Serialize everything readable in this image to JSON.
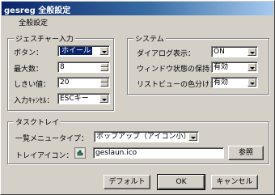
{
  "window": {
    "title": "gesreg 全般設定"
  },
  "tab": {
    "label": "全般設定"
  },
  "gesture_group": {
    "legend": "ジェスチャー入力",
    "button_label": "ボタン：",
    "button_value": "ホイール",
    "max_count_label": "最大数：",
    "max_count_value": "8",
    "threshold_label": "しきい値：",
    "threshold_value": "20",
    "input_cancel_label": "入力ｷｬﾝｾﾙ：",
    "input_cancel_value": "ESCキー"
  },
  "system_group": {
    "legend": "システム",
    "dialog_label": "ダイアログ表示：",
    "dialog_value": "ON",
    "window_state_label": "ウィンドウ状態の保持：",
    "window_state_value": "有効",
    "listview_label": "リストビューの色分け：",
    "listview_value": "有効"
  },
  "tasktray_group": {
    "legend": "タスクトレイ",
    "menu_type_label": "一覧メニュータイプ：",
    "menu_type_value": "ポップアップ（アイコン小）",
    "tray_icon_label": "トレイアイコン：",
    "tray_icon_path": "geslaun.ico",
    "browse_label": "参照"
  },
  "buttons": {
    "default": "デフォルト",
    "ok": "OK",
    "cancel": "キャンセル"
  }
}
